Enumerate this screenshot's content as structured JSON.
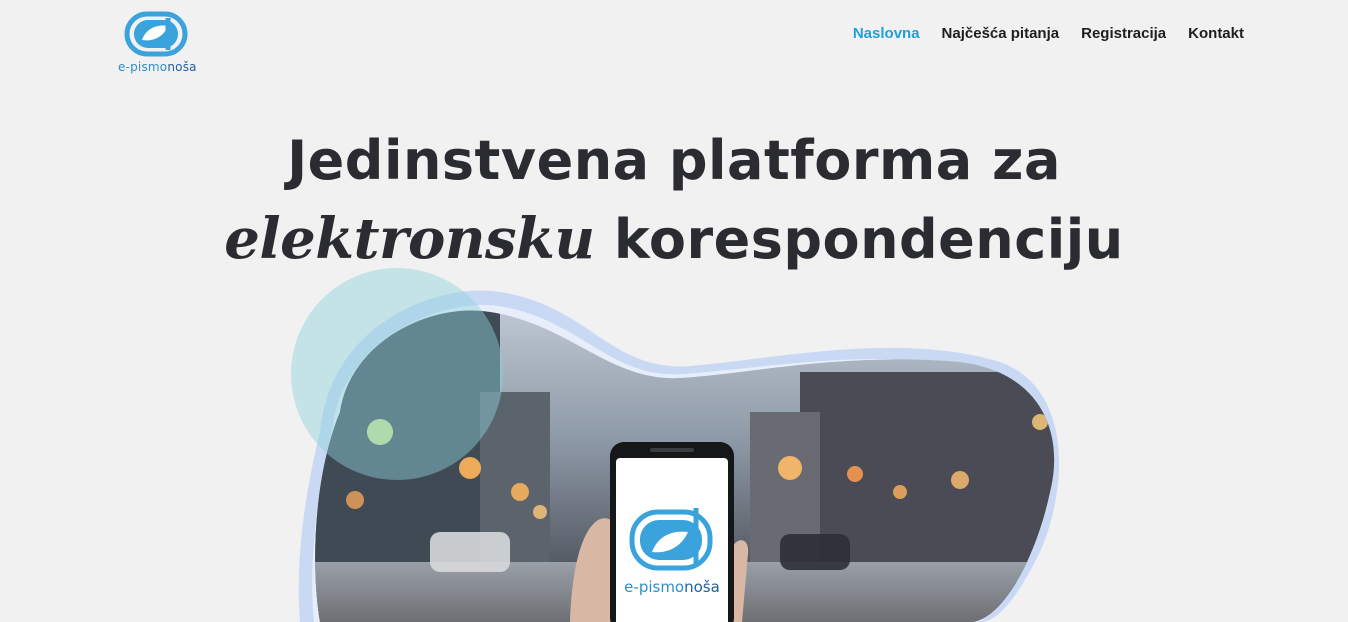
{
  "header": {
    "logo_text_a": "e-pismo",
    "logo_text_b": "noša"
  },
  "nav": {
    "items": [
      {
        "label": "Naslovna",
        "active": true
      },
      {
        "label": "Najčešća pitanja",
        "active": false
      },
      {
        "label": "Registracija",
        "active": false
      },
      {
        "label": "Kontakt",
        "active": false
      }
    ]
  },
  "hero": {
    "line1": "Jedinstvena platforma za",
    "line2_em": "elektronsku",
    "line2_rest": " korespondenciju"
  },
  "phone": {
    "label_a": "e-pismo",
    "label_b": "noša"
  },
  "colors": {
    "accent": "#1ea0dc",
    "text": "#2b2c31",
    "background": "#f1f1f1"
  },
  "icons": [
    "logo-envelope-leaf-icon"
  ]
}
